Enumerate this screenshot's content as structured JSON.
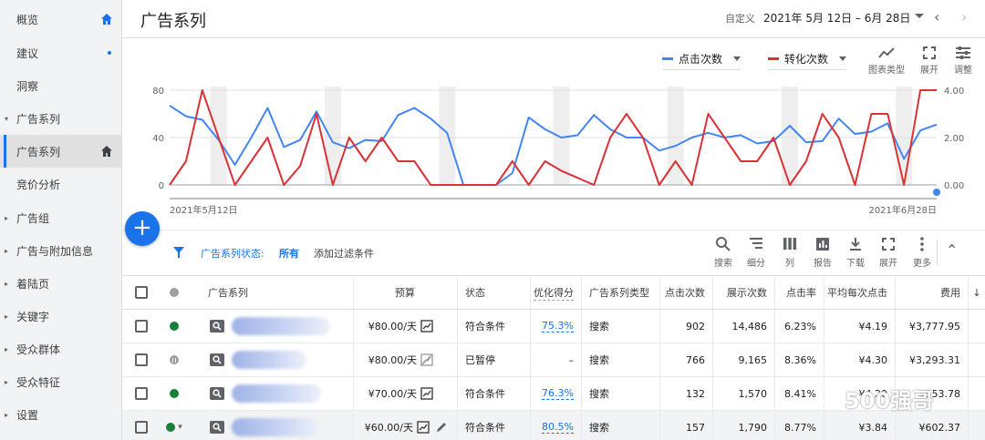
{
  "sidebar": {
    "items": [
      {
        "label": "概览",
        "icon": "home-icon"
      },
      {
        "label": "建议",
        "badge": "dot"
      },
      {
        "label": "洞察"
      },
      {
        "label": "广告系列",
        "section": true
      },
      {
        "label": "广告系列",
        "active": true,
        "icon": "home-icon"
      },
      {
        "label": "竞价分析"
      },
      {
        "label": "广告组",
        "section": true
      },
      {
        "label": "广告与附加信息",
        "section": true
      },
      {
        "label": "着陆页",
        "section": true
      },
      {
        "label": "关键字",
        "section": true
      },
      {
        "label": "受众群体",
        "section": true
      },
      {
        "label": "受众特征",
        "section": true
      },
      {
        "label": "设置",
        "section": true
      }
    ]
  },
  "header": {
    "title": "广告系列",
    "date_prefix": "自定义",
    "date_range": "2021年 5月 12日 – 6月 28日",
    "prev_symbol": "‹",
    "next_symbol": "›"
  },
  "chart_controls": {
    "series1_label": "点击次数",
    "series2_label": "转化次数",
    "tools": [
      {
        "label": "图表类型",
        "icon": "chart-type-icon"
      },
      {
        "label": "展开",
        "icon": "expand-icon"
      },
      {
        "label": "调整",
        "icon": "adjust-icon"
      }
    ]
  },
  "colors": {
    "accent": "#1a73e8",
    "series1": "#4285f4",
    "series2": "#db3236"
  },
  "chart_data": {
    "type": "line",
    "x_start_label": "2021年5月12日",
    "x_end_label": "2021年6月28日",
    "left_axis": {
      "ticks": [
        "0",
        "40",
        "80"
      ],
      "ylim": [
        0,
        90
      ]
    },
    "right_axis": {
      "ticks": [
        "0.00",
        "2.00",
        "4.00"
      ],
      "ylim": [
        0,
        4.5
      ]
    },
    "series": [
      {
        "name": "点击次数",
        "axis": "left",
        "values": [
          67,
          58,
          55,
          38,
          17,
          40,
          65,
          32,
          38,
          62,
          36,
          31,
          38,
          37,
          59,
          65,
          56,
          44,
          0,
          0,
          0,
          10,
          57,
          47,
          40,
          42,
          59,
          47,
          40,
          40,
          29,
          33,
          40,
          44,
          40,
          42,
          35,
          37,
          50,
          36,
          37,
          56,
          43,
          45,
          52,
          22,
          46,
          51
        ]
      },
      {
        "name": "转化次数",
        "axis": "right",
        "values": [
          0,
          1,
          4,
          2,
          0,
          1,
          2,
          0,
          0.8,
          3,
          0,
          2,
          1,
          2,
          1,
          1,
          0,
          0,
          0,
          0,
          0,
          1,
          0,
          1,
          0.6,
          0.3,
          0,
          2,
          3,
          2,
          0,
          1,
          0,
          3,
          2,
          1,
          1,
          2,
          0,
          1,
          3,
          2,
          0,
          3,
          3,
          0,
          4,
          4
        ]
      }
    ],
    "grid": true
  },
  "fab": {
    "symbol": "+"
  },
  "filter": {
    "status_label": "广告系列状态:",
    "status_value": "所有",
    "add_filter": "添加过滤条件"
  },
  "table_tools": [
    {
      "label": "搜索",
      "icon": "search-icon"
    },
    {
      "label": "细分",
      "icon": "segment-icon"
    },
    {
      "label": "列",
      "icon": "columns-icon"
    },
    {
      "label": "报告",
      "icon": "report-icon"
    },
    {
      "label": "下载",
      "icon": "download-icon"
    },
    {
      "label": "展开",
      "icon": "expand-icon"
    },
    {
      "label": "更多",
      "icon": "more-icon"
    }
  ],
  "table": {
    "headers": {
      "campaign": "广告系列",
      "budget": "预算",
      "status": "状态",
      "opt": "优化得分",
      "type": "广告系列类型",
      "clicks": "点击次数",
      "impr": "展示次数",
      "ctr": "点击率",
      "cpc": "平均每次点击",
      "cost": "费用"
    },
    "rows": [
      {
        "budget": "¥80.00/天",
        "status": "符合条件",
        "opt": "75.3%",
        "type": "搜索",
        "clicks": "902",
        "impr": "14,486",
        "ctr": "6.23%",
        "cpc": "¥4.19",
        "cost": "¥3,777.95",
        "state": "enabled"
      },
      {
        "budget": "¥80.00/天",
        "status": "已暂停",
        "opt": "–",
        "type": "搜索",
        "clicks": "766",
        "impr": "9,165",
        "ctr": "8.36%",
        "cpc": "¥4.30",
        "cost": "¥3,293.31",
        "state": "paused"
      },
      {
        "budget": "¥70.00/天",
        "status": "符合条件",
        "opt": "76.3%",
        "type": "搜索",
        "clicks": "132",
        "impr": "1,570",
        "ctr": "8.41%",
        "cpc": "¥4.20",
        "cost": "¥553.78",
        "state": "enabled"
      },
      {
        "budget": "¥60.00/天",
        "status": "符合条件",
        "opt": "80.5%",
        "type": "搜索",
        "clicks": "157",
        "impr": "1,790",
        "ctr": "8.77%",
        "cpc": "¥3.84",
        "cost": "¥602.37",
        "state": "enabled"
      }
    ]
  },
  "watermark": "500强哥"
}
